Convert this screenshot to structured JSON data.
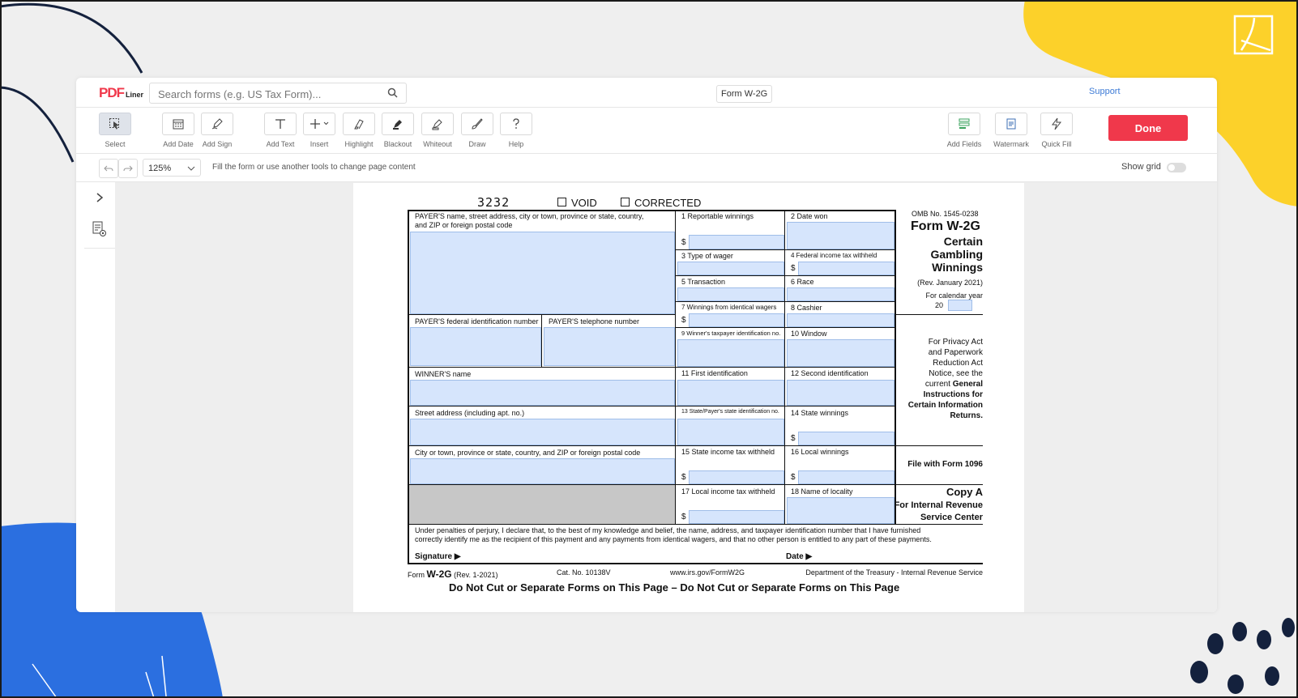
{
  "app": {
    "logo_main": "PDF",
    "logo_sub": "Liner",
    "search_placeholder": "Search forms (e.g. US Tax Form)...",
    "form_name": "Form W-2G",
    "support_label": "Support",
    "done_label": "Done"
  },
  "toolbar": {
    "tools": [
      {
        "label": "Select",
        "icon": "cursor-icon"
      },
      {
        "label": "Add Date",
        "icon": "calendar-icon"
      },
      {
        "label": "Add Sign",
        "icon": "pen-icon"
      },
      {
        "label": "Add Text",
        "icon": "text-icon"
      },
      {
        "label": "Insert",
        "icon": "plus-icon"
      },
      {
        "label": "Highlight",
        "icon": "highlighter-icon"
      },
      {
        "label": "Blackout",
        "icon": "blackout-icon"
      },
      {
        "label": "Whiteout",
        "icon": "eraser-icon"
      },
      {
        "label": "Draw",
        "icon": "brush-icon"
      },
      {
        "label": "Help",
        "icon": "help-icon"
      }
    ],
    "right_tools": [
      {
        "label": "Add Fields",
        "icon": "fields-icon"
      },
      {
        "label": "Watermark",
        "icon": "watermark-icon"
      },
      {
        "label": "Quick Fill",
        "icon": "lightning-icon"
      }
    ]
  },
  "subbar": {
    "zoom": "125%",
    "hint": "Fill the form or use another tools to change page content",
    "show_grid_label": "Show grid"
  },
  "form": {
    "number_code": "3232",
    "void_label": "VOID",
    "corrected_label": "CORRECTED",
    "payer_name_label_1": "PAYER'S name, street address, city or town, province or state, country,",
    "payer_name_label_2": "and ZIP or foreign postal code",
    "b1": "1  Reportable winnings",
    "b2": "2  Date won",
    "b3": "3  Type of wager",
    "b4": "4  Federal income tax withheld",
    "b5": "5  Transaction",
    "b6": "6  Race",
    "b7": "7  Winnings from identical wagers",
    "b8": "8  Cashier",
    "b9": "9  Winner's taxpayer identification no.",
    "b10": "10  Window",
    "b11": "11  First identification",
    "b12": "12  Second identification",
    "b13": "13  State/Payer's state identification no.",
    "b14": "14  State winnings",
    "b15": "15  State income tax withheld",
    "b16": "16  Local winnings",
    "b17": "17  Local income tax withheld",
    "b18": "18  Name of locality",
    "payer_fein": "PAYER'S federal identification number",
    "payer_phone": "PAYER'S telephone number",
    "winner_name": "WINNER'S name",
    "street": "Street address (including apt. no.)",
    "city": "City or town, province or state, country, and ZIP or foreign postal code",
    "dollar": "$",
    "omb": "OMB No. 1545-0238",
    "form_title": "Form W-2G",
    "certain_1": "Certain",
    "certain_2": "Gambling",
    "certain_3": "Winnings",
    "rev": "(Rev. January 2021)",
    "cal_year": "For calendar year",
    "year_prefix": "20",
    "privacy_1": "For Privacy Act",
    "privacy_2": "and Paperwork",
    "privacy_3": "Reduction Act",
    "privacy_4": "Notice, see the",
    "privacy_5_a": "current ",
    "privacy_5_b": "General",
    "privacy_6": "Instructions for",
    "privacy_7": "Certain Information",
    "privacy_8": "Returns.",
    "file_with": "File with Form 1096",
    "copy_a": "Copy A",
    "for_irs_1": "For Internal Revenue",
    "for_irs_2": "Service Center",
    "perjury_1": "Under penalties of perjury, I declare that, to the best of my knowledge and belief, the name, address, and taxpayer identification number that I have furnished",
    "perjury_2": "correctly identify me as the recipient of this payment and any payments from identical wagers, and that no other person is entitled to any part of these payments.",
    "signature": "Signature ▶",
    "date": "Date ▶",
    "footer_form": "Form",
    "footer_w2g": "W-2G",
    "footer_rev": "(Rev. 1-2021)",
    "footer_cat": "Cat. No. 10138V",
    "footer_url": "www.irs.gov/FormW2G",
    "footer_dept": "Department of the Treasury - Internal Revenue Service",
    "do_not_cut": "Do Not Cut or Separate Forms on This Page  –  Do Not Cut or Separate Forms on This Page"
  },
  "colors": {
    "brand_red": "#f0384b",
    "accent_blue": "#3d7bd6",
    "field_fill": "#d6e5fc",
    "deco_yellow": "#fcd12a",
    "deco_blue": "#2b6fe0",
    "deco_navy": "#14213d"
  }
}
